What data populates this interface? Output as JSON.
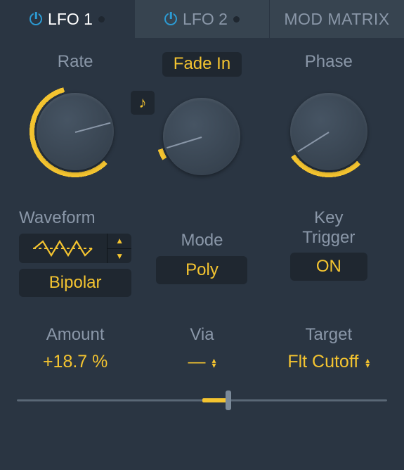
{
  "tabs": {
    "lfo1": "LFO 1",
    "lfo2": "LFO 2",
    "modmatrix": "MOD MATRIX"
  },
  "knobs": {
    "rate_label": "Rate",
    "fade_label": "Fade In",
    "phase_label": "Phase"
  },
  "row2": {
    "waveform_label": "Waveform",
    "bipolar_label": "Bipolar",
    "mode_label": "Mode",
    "mode_value": "Poly",
    "keytrigger_label": "Key\nTrigger",
    "keytrigger_value": "ON"
  },
  "row3": {
    "amount_label": "Amount",
    "amount_value": "+18.7 %",
    "via_label": "Via",
    "via_value": "—",
    "target_label": "Target",
    "target_value": "Flt Cutoff"
  },
  "slider": {
    "value_pct": 18.7
  }
}
